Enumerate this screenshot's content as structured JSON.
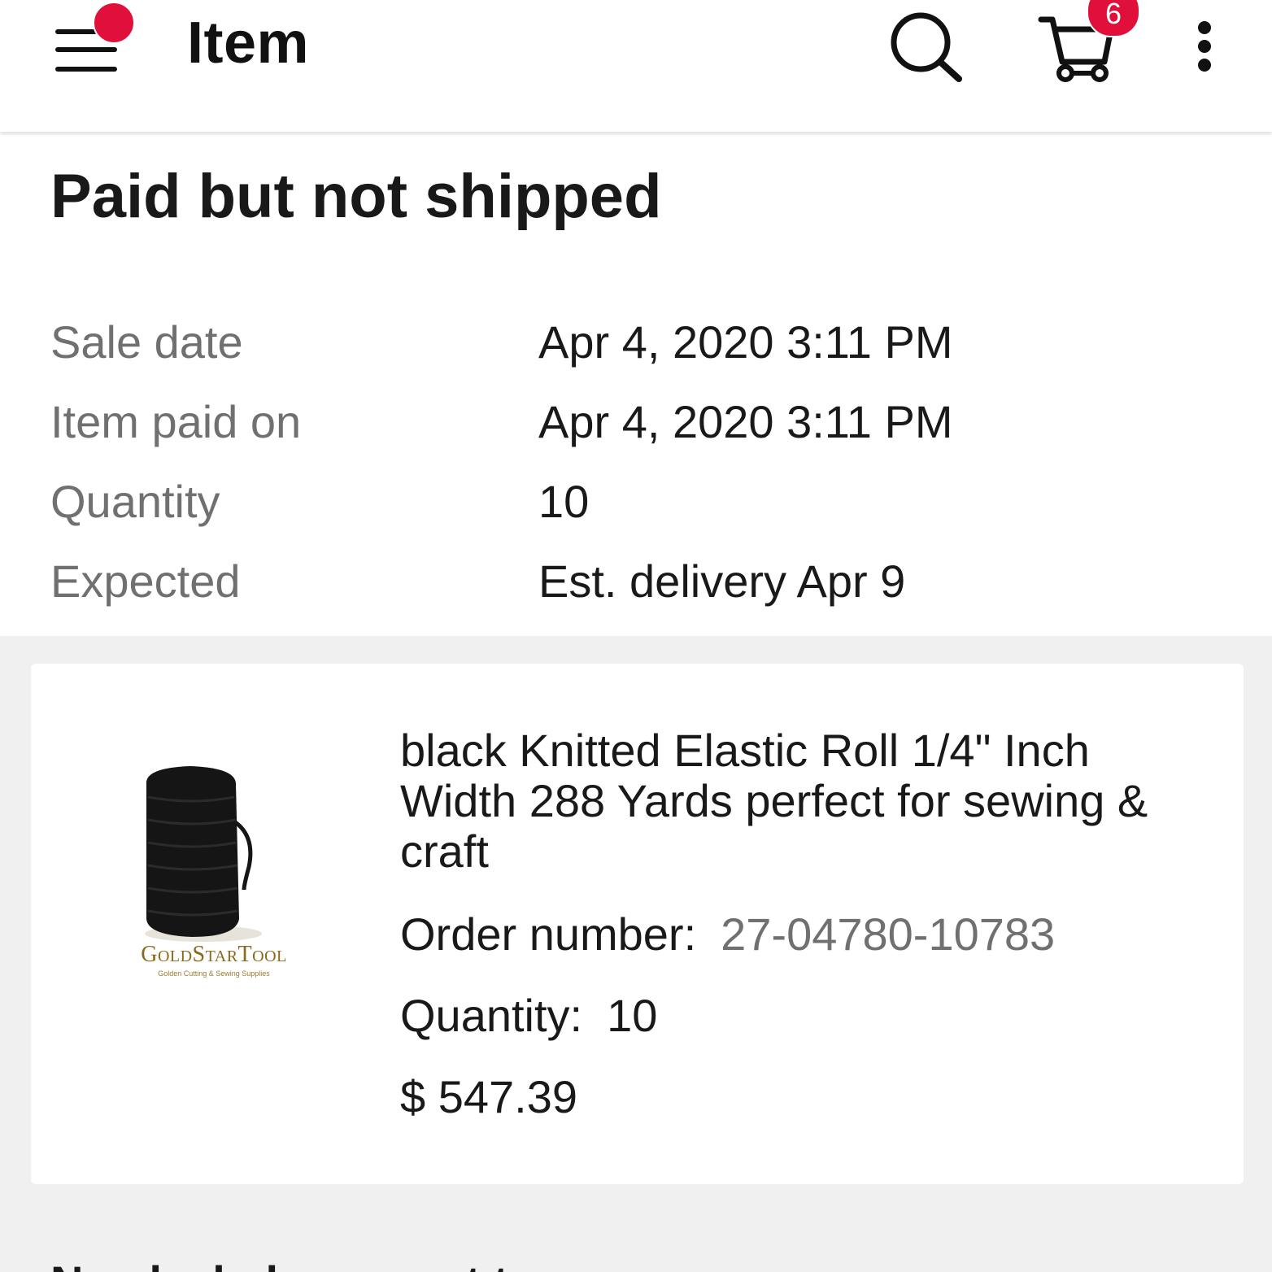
{
  "appbar": {
    "title": "Item",
    "cart_count": "6",
    "icons": [
      "menu-icon",
      "search-icon",
      "cart-icon",
      "more-vertical-icon"
    ],
    "accent_color": "#e0103a"
  },
  "status": {
    "title": "Paid but not shipped",
    "rows": [
      {
        "label": "Sale date",
        "value": "Apr 4, 2020 3:11 PM"
      },
      {
        "label": "Item paid on",
        "value": "Apr 4, 2020 3:11 PM"
      },
      {
        "label": "Quantity",
        "value": "10"
      },
      {
        "label": "Expected",
        "value": "Est. delivery Apr 9"
      }
    ]
  },
  "item": {
    "brand": "GoldStarTool",
    "brand_tagline": "Golden Cutting & Sewing Supplies",
    "title": "black Knitted Elastic Roll 1/4\" Inch Width 288 Yards perfect for sewing & craft",
    "order_number_label": "Order number:",
    "order_number": "27-04780-10783",
    "quantity_label": "Quantity:",
    "quantity": "10",
    "price": "$ 547.39"
  },
  "next_section": {
    "title": "Need a help or want to..."
  }
}
